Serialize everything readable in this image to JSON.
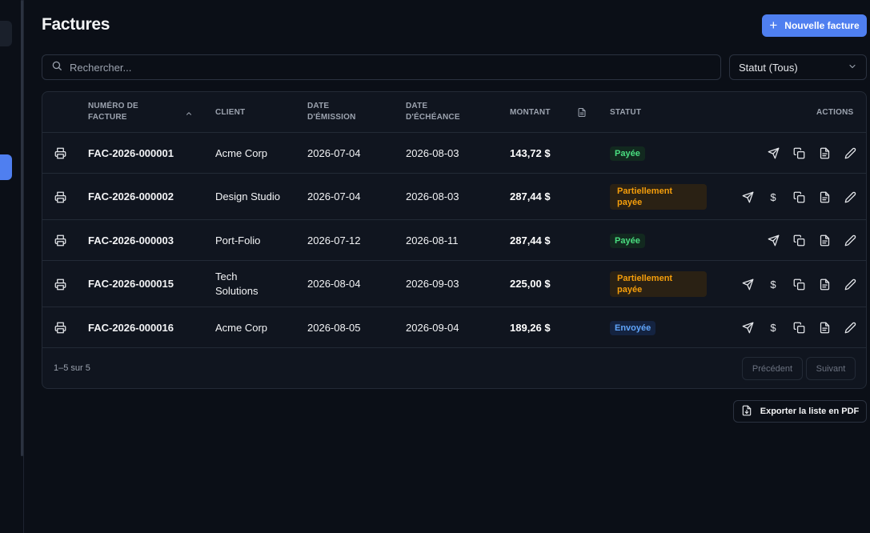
{
  "page": {
    "title": "Factures"
  },
  "toolbar": {
    "new_invoice_label": "Nouvelle facture"
  },
  "search": {
    "placeholder": "Rechercher..."
  },
  "filter": {
    "status_label": "Statut (Tous)"
  },
  "table": {
    "headers": {
      "number": "NUMÉRO DE FACTURE",
      "client": "CLIENT",
      "issue_date": "DATE D'ÉMISSION",
      "due_date": "DATE D'ÉCHÉANCE",
      "amount": "MONTANT",
      "status": "STATUT",
      "actions": "ACTIONS"
    },
    "rows": [
      {
        "number": "FAC-2026-000001",
        "client": "Acme Corp",
        "issue_date": "2026-07-04",
        "due_date": "2026-08-03",
        "amount": "143,72 $",
        "status": "Payée",
        "status_type": "paid"
      },
      {
        "number": "FAC-2026-000002",
        "client": "Design Studio",
        "issue_date": "2026-07-04",
        "due_date": "2026-08-03",
        "amount": "287,44 $",
        "status": "Partiellement payée",
        "status_type": "partial"
      },
      {
        "number": "FAC-2026-000003",
        "client": "Port-Folio",
        "issue_date": "2026-07-12",
        "due_date": "2026-08-11",
        "amount": "287,44 $",
        "status": "Payée",
        "status_type": "paid"
      },
      {
        "number": "FAC-2026-000015",
        "client": "Tech Solutions",
        "issue_date": "2026-08-04",
        "due_date": "2026-09-03",
        "amount": "225,00 $",
        "status": "Partiellement payée",
        "status_type": "partial"
      },
      {
        "number": "FAC-2026-000016",
        "client": "Acme Corp",
        "issue_date": "2026-08-05",
        "due_date": "2026-09-04",
        "amount": "189,26 $",
        "status": "Envoyée",
        "status_type": "sent"
      }
    ]
  },
  "pagination": {
    "summary": "1–5 sur 5",
    "prev_label": "Précédent",
    "next_label": "Suivant"
  },
  "export": {
    "label": "Exporter la liste en PDF"
  },
  "colors": {
    "accent": "#4f7ff0",
    "paid": "#4ade80",
    "partial": "#f59e0b",
    "sent": "#60a5fa"
  },
  "icons": {
    "row": [
      "printer-icon"
    ],
    "actions": [
      "send-icon",
      "dollar-icon",
      "copy-icon",
      "file-icon",
      "pencil-icon"
    ]
  }
}
